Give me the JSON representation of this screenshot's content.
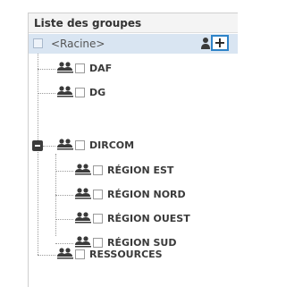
{
  "panel": {
    "title": "Liste des groupes"
  },
  "root": {
    "label": "<Racine>",
    "add_symbol": "+"
  },
  "nodes": [
    {
      "label": "DAF"
    },
    {
      "label": "DG"
    },
    {
      "label": "DIRCOM"
    },
    {
      "label": "RÉGION EST"
    },
    {
      "label": "RÉGION NORD"
    },
    {
      "label": "RÉGION OUEST"
    },
    {
      "label": "RÉGION SUD"
    },
    {
      "label": "RESSOURCES"
    }
  ],
  "colors": {
    "selection": "#d9e5f2",
    "accent_border": "#2e83c8",
    "icon": "#3a3a3a"
  },
  "icons": {
    "group": "group-icon",
    "user": "person-icon",
    "add": "plus-icon",
    "collapse": "minus-box-icon"
  }
}
